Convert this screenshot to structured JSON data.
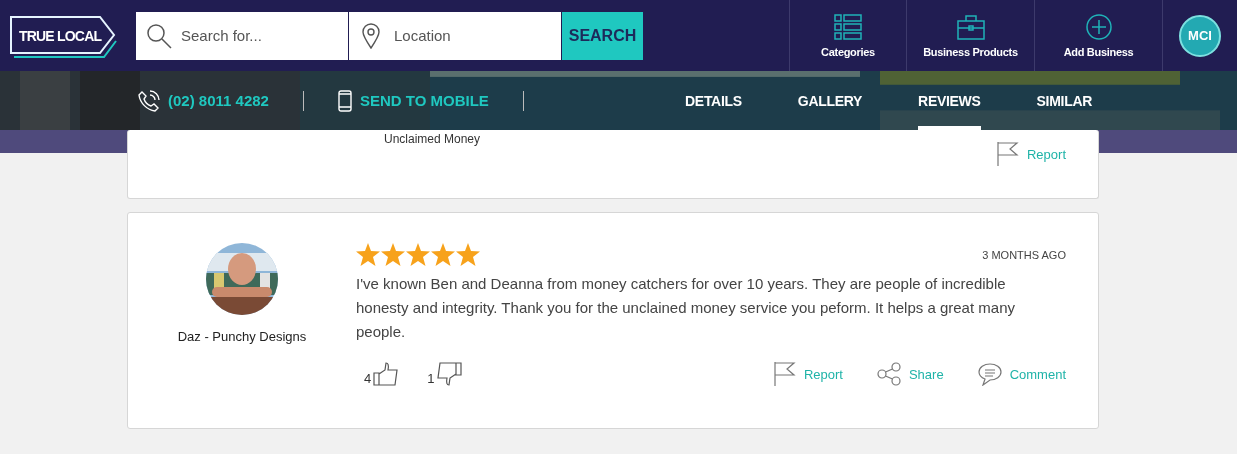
{
  "header": {
    "logo": "TRUE LOCAL",
    "search": {
      "placeholder": "Search for..."
    },
    "location": {
      "placeholder": "Location"
    },
    "search_button": "SEARCH",
    "nav": [
      {
        "label": "Categories",
        "kind": "grid"
      },
      {
        "label": "Business Products",
        "kind": "briefcase"
      },
      {
        "label": "Add Business",
        "kind": "plus"
      }
    ],
    "account_initials": "MCI"
  },
  "subnav": {
    "phone": "(02) 8011 4282",
    "send": "SEND TO MOBILE",
    "tabs": [
      {
        "label": "DETAILS",
        "selected": false
      },
      {
        "label": "GALLERY",
        "selected": false
      },
      {
        "label": "REVIEWS",
        "selected": true
      },
      {
        "label": "SIMILAR",
        "selected": false
      }
    ]
  },
  "reviews": [
    {
      "kind": "partial",
      "title": "Unclaimed Money",
      "actions": [
        {
          "kind": "report",
          "label": "Report"
        }
      ]
    },
    {
      "kind": "full",
      "author": "Daz - Punchy Designs",
      "stars": 5,
      "date": "3 MONTHS AGO",
      "text": "I've known Ben and Deanna from money catchers for over 10 years. They are people of incredible honesty and integrity. Thank you for the unclained money service you peform. It helps a great many people.",
      "likes": "4",
      "dislikes": "1",
      "actions": [
        {
          "kind": "report",
          "label": "Report"
        },
        {
          "kind": "share",
          "label": "Share"
        },
        {
          "kind": "comment",
          "label": "Comment"
        }
      ]
    }
  ]
}
